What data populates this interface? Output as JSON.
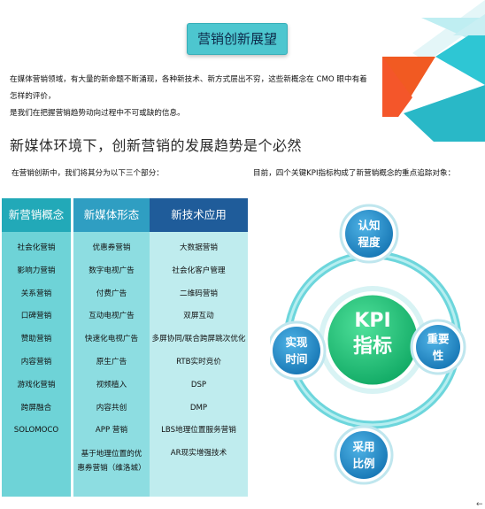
{
  "header": {
    "title": "营销创新展望"
  },
  "intro": {
    "line1": "在媒体营销领域，有大量的新命题不断涌现，各种新技术、新方式层出不穷，这些新概念在 CMO 眼中有着怎样的评价，",
    "line2": "是我们在把握营销趋势动向过程中不可或缺的信息。"
  },
  "headline": "新媒体环境下，创新营销的发展趋势是个必然",
  "left_caption": "在营销创新中，我们将其分为以下三个部分：",
  "right_caption": "目前，四个关键KPI指标构成了新营销概念的重点追踪对象：",
  "columns": [
    {
      "title": "新营销概念",
      "items": [
        "社会化营销",
        "影响力营销",
        "关系营销",
        "口碑营销",
        "赞助营销",
        "内容营销",
        "游戏化营销",
        "跨屏融合",
        "SOLOMOCO"
      ]
    },
    {
      "title": "新媒体形态",
      "items": [
        "优惠券营销",
        "数字电视广告",
        "付费广告",
        "互动电视广告",
        "快速化电视广告",
        "原生广告",
        "视频植入",
        "内容共创",
        "APP 营销",
        "基于地理位置的优",
        "惠券营销（维洛城）"
      ]
    },
    {
      "title": "新技术应用",
      "items": [
        "大数据营销",
        "社会化客户管理",
        "二维码营销",
        "双屏互动",
        "多屏协同/联合跨屏跳次优化",
        "RTB实时竞价",
        "DSP",
        "DMP",
        "LBS地理位置服务营销",
        "AR现实增强技术"
      ]
    }
  ],
  "kpi": {
    "center_line1": "KPI",
    "center_line2": "指标",
    "nodes": {
      "top": [
        "认知",
        "程度"
      ],
      "right": [
        "重要",
        "性"
      ],
      "bottom": [
        "采用",
        "比例"
      ],
      "left": [
        "实现",
        "时间"
      ]
    }
  },
  "misc": {
    "corner_mark": "←"
  },
  "colors": {
    "title_button": "#4dc6cf",
    "col1_head": "#22a9b8",
    "col2_head": "#2f9ec2",
    "col3_head": "#1f5c9a",
    "center_green": "#1ec27a",
    "node_blue": "#1f88c4",
    "ring": "#5fd2d8",
    "deco_orange": "#f15a22",
    "deco_cyan": "#2ec6d4"
  }
}
